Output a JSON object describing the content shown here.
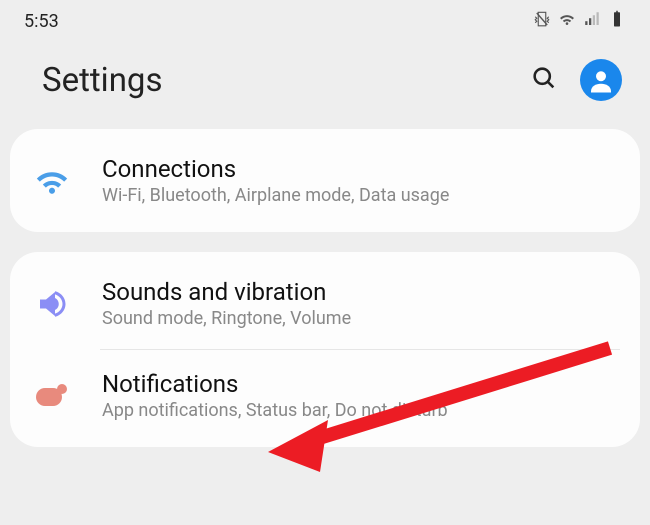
{
  "status": {
    "time": "5:53"
  },
  "header": {
    "title": "Settings"
  },
  "sections": {
    "connections": {
      "title": "Connections",
      "sub": "Wi-Fi, Bluetooth, Airplane mode, Data usage"
    },
    "sounds": {
      "title": "Sounds and vibration",
      "sub": "Sound mode, Ringtone, Volume"
    },
    "notifications": {
      "title": "Notifications",
      "sub": "App notifications, Status bar, Do not disturb"
    }
  },
  "colors": {
    "wifi": "#4a9ee8",
    "sound": "#8b8ef5",
    "notif": "#e88a7d",
    "account": "#1a87ec",
    "arrow": "#ec1c24"
  }
}
